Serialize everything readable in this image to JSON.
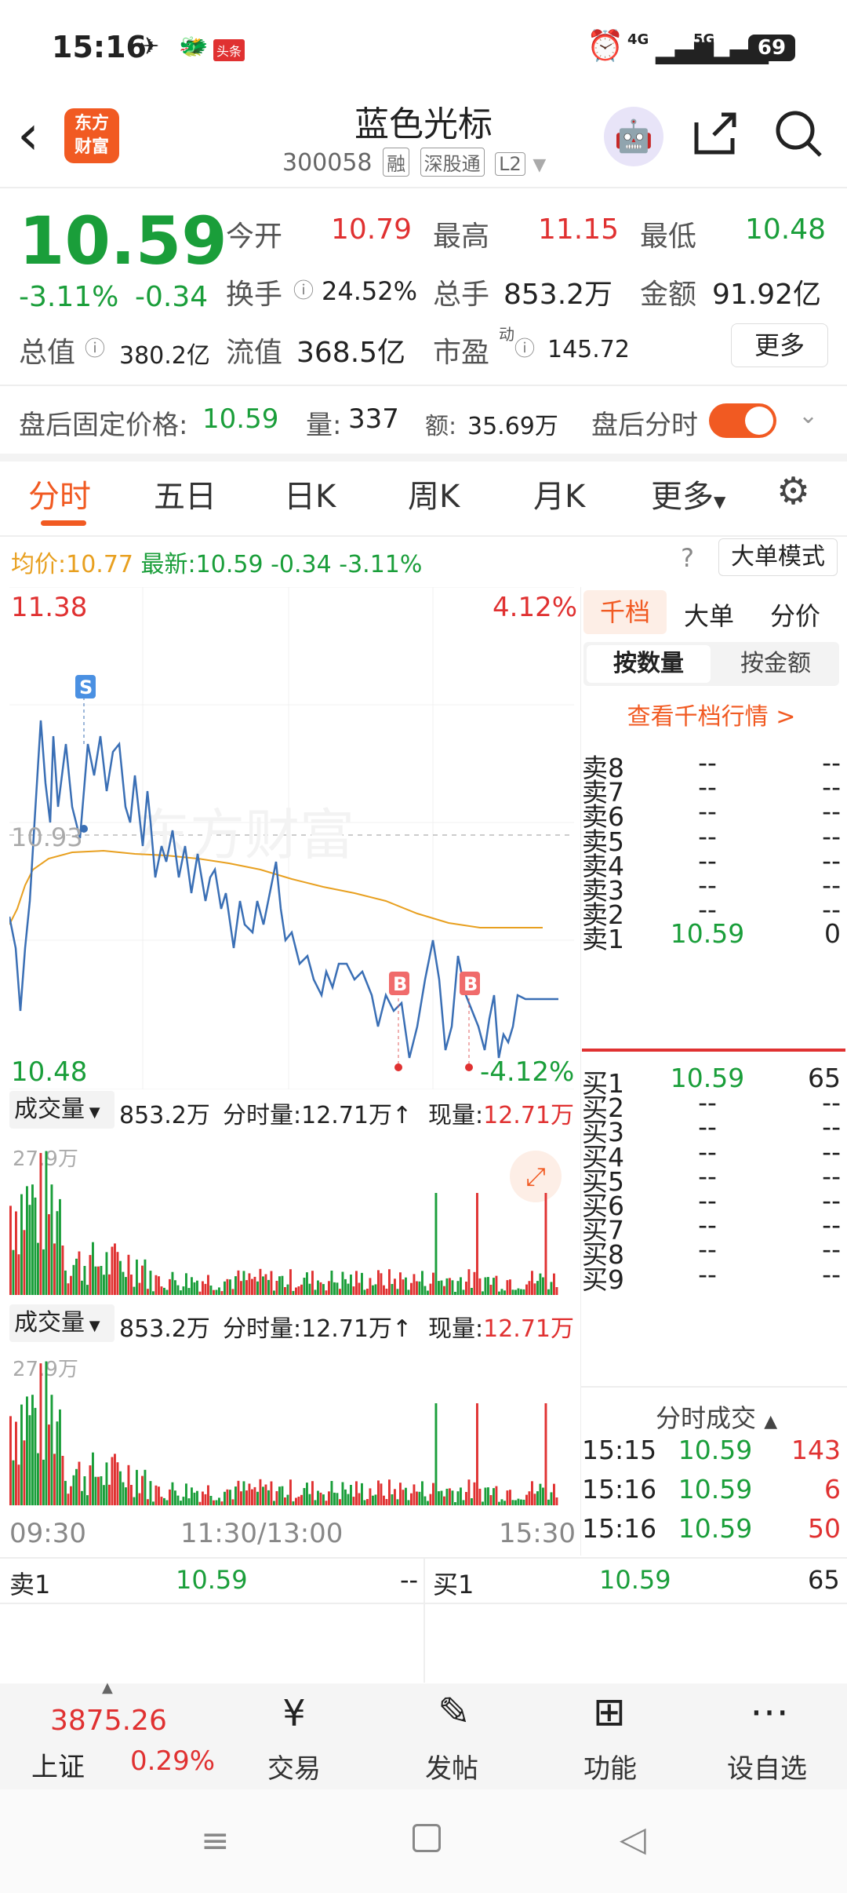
{
  "status": {
    "time": "15:16",
    "battery": "69",
    "net1": "4G",
    "net2": "5G",
    "news_badge": "头条"
  },
  "header": {
    "logo_line1": "东方",
    "logo_line2": "财富",
    "title": "蓝色光标",
    "code": "300058",
    "tags": [
      "融",
      "深股通",
      "L2"
    ]
  },
  "quote": {
    "price": "10.59",
    "change_pct": "-3.11%",
    "change": "-0.34",
    "open_label": "今开",
    "open": "10.79",
    "high_label": "最高",
    "high": "11.15",
    "low_label": "最低",
    "low": "10.48",
    "turnover_label": "换手",
    "turnover": "24.52%",
    "volume_label": "总手",
    "volume": "853.2万",
    "amount_label": "金额",
    "amount": "91.92亿",
    "mcap_label": "总值",
    "mcap": "380.2亿",
    "float_label": "流值",
    "float_mcap": "368.5亿",
    "pe_label": "市盈",
    "pe_sup": "动",
    "pe": "145.72",
    "more": "更多"
  },
  "after_hours": {
    "label": "盘后固定价格:",
    "price": "10.59",
    "vol_label": "量:",
    "vol": "337",
    "amt_label": "额:",
    "amt": "35.69万",
    "toggle_label": "盘后分时"
  },
  "tabs": [
    "分时",
    "五日",
    "日K",
    "周K",
    "月K",
    "更多"
  ],
  "info_line": {
    "avg_label": "均价:",
    "avg": "10.77",
    "latest_label": "最新:",
    "latest": "10.59",
    "chg": "-0.34",
    "pct": "-3.11%",
    "mode": "大单模式"
  },
  "chart": {
    "y_max": "11.38",
    "y_min": "10.48",
    "pct_max": "4.12%",
    "pct_min": "-4.12%",
    "mid": "10.93",
    "watermark": "东方财富",
    "marker_s": "S",
    "marker_b": "B",
    "time_start": "09:30",
    "time_mid": "11:30/13:00",
    "time_end": "15:30"
  },
  "vol_panel": {
    "label": "成交量",
    "total": "853.2万",
    "fs_label": "分时量:",
    "fs": "12.71万",
    "now_label": "现量:",
    "now": "12.71万",
    "max": "27.9万"
  },
  "right_tabs": [
    "千档",
    "大单",
    "分价"
  ],
  "seg": [
    "按数量",
    "按金额"
  ],
  "view_more": "查看千档行情 >",
  "asks": [
    {
      "n": "卖8",
      "p": "--",
      "v": "--"
    },
    {
      "n": "卖7",
      "p": "--",
      "v": "--"
    },
    {
      "n": "卖6",
      "p": "--",
      "v": "--"
    },
    {
      "n": "卖5",
      "p": "--",
      "v": "--"
    },
    {
      "n": "卖4",
      "p": "--",
      "v": "--"
    },
    {
      "n": "卖3",
      "p": "--",
      "v": "--"
    },
    {
      "n": "卖2",
      "p": "--",
      "v": "--"
    },
    {
      "n": "卖1",
      "p": "10.59",
      "v": "0"
    }
  ],
  "bids": [
    {
      "n": "买1",
      "p": "10.59",
      "v": "65"
    },
    {
      "n": "买2",
      "p": "--",
      "v": "--"
    },
    {
      "n": "买3",
      "p": "--",
      "v": "--"
    },
    {
      "n": "买4",
      "p": "--",
      "v": "--"
    },
    {
      "n": "买5",
      "p": "--",
      "v": "--"
    },
    {
      "n": "买6",
      "p": "--",
      "v": "--"
    },
    {
      "n": "买7",
      "p": "--",
      "v": "--"
    },
    {
      "n": "买8",
      "p": "--",
      "v": "--"
    },
    {
      "n": "买9",
      "p": "--",
      "v": "--"
    }
  ],
  "trades_title": "分时成交",
  "trades": [
    {
      "t": "15:15",
      "p": "10.59",
      "v": "143"
    },
    {
      "t": "15:16",
      "p": "10.59",
      "v": "6"
    },
    {
      "t": "15:16",
      "p": "10.59",
      "v": "50"
    }
  ],
  "footer_quote": {
    "sell_label": "卖1",
    "sell_price": "10.59",
    "sell_vol": "--",
    "buy_label": "买1",
    "buy_price": "10.59",
    "buy_vol": "65"
  },
  "bottom_nav": {
    "index_value": "3875.26",
    "index_name": "上证",
    "index_pct": "0.29%",
    "items": [
      "交易",
      "发帖",
      "功能",
      "设自选"
    ]
  }
}
